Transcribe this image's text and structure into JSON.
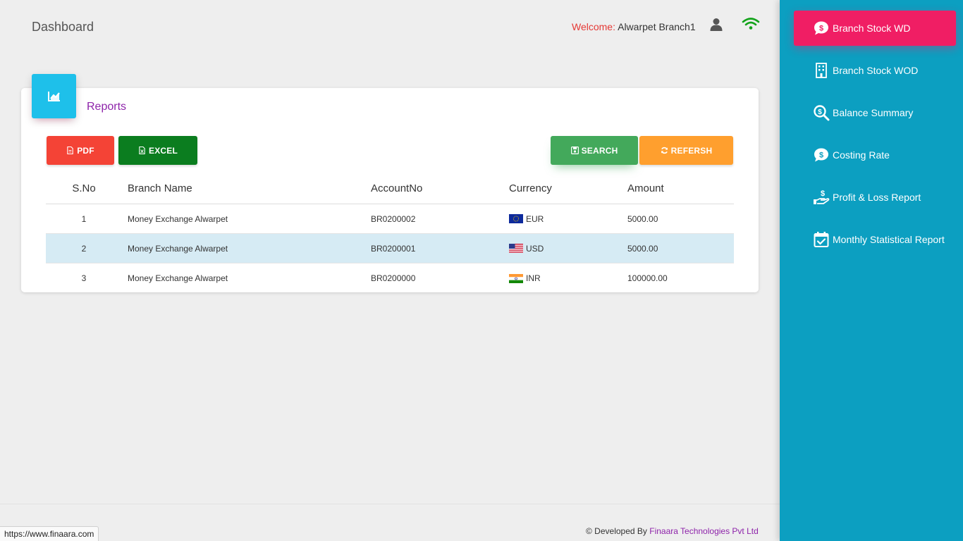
{
  "header": {
    "title": "Dashboard",
    "welcome_label": "Welcome:",
    "welcome_user": "Alwarpet Branch1",
    "icons": {
      "user": "user-icon",
      "connection": "wifi-icon"
    },
    "colors": {
      "welcome_label": "#e53935",
      "wifi": "#13a31b"
    }
  },
  "card": {
    "title": "Reports",
    "icon": "chart-line-icon",
    "buttons": {
      "pdf": "PDF",
      "excel": "EXCEL",
      "search": "SEARCH",
      "refresh": "REFERSH"
    },
    "colors": {
      "pdf": "#f44336",
      "excel": "#0b7d1f",
      "search": "#43a95b",
      "refresh": "#ff9f2e",
      "accent": "#1ec0ea"
    }
  },
  "table": {
    "headers": {
      "sno": "S.No",
      "branch": "Branch Name",
      "account": "AccountNo",
      "currency": "Currency",
      "amount": "Amount"
    },
    "rows": [
      {
        "sno": "1",
        "branch": "Money Exchange Alwarpet",
        "account": "BR0200002",
        "currency": "EUR",
        "flag": "eu-flag-icon",
        "amount": "5000.00"
      },
      {
        "sno": "2",
        "branch": "Money Exchange Alwarpet",
        "account": "BR0200001",
        "currency": "USD",
        "flag": "us-flag-icon",
        "amount": "5000.00"
      },
      {
        "sno": "3",
        "branch": "Money Exchange Alwarpet",
        "account": "BR0200000",
        "currency": "INR",
        "flag": "in-flag-icon",
        "amount": "100000.00"
      }
    ]
  },
  "footer": {
    "prefix": "© Developed By",
    "company": "Finaara Technologies Pvt Ltd",
    "status_url": "https://www.finaara.com"
  },
  "sidebar": {
    "colors": {
      "background": "#0c9fc1",
      "active": "#f01e64"
    },
    "items": [
      {
        "label": "Branch Stock WD",
        "icon": "dollar-chat-icon",
        "active": true
      },
      {
        "label": "Branch Stock WOD",
        "icon": "building-icon",
        "active": false
      },
      {
        "label": "Balance Summary",
        "icon": "search-dollar-icon",
        "active": false
      },
      {
        "label": "Costing Rate",
        "icon": "dollar-chat-icon",
        "active": false
      },
      {
        "label": "Profit & Loss Report",
        "icon": "hand-dollar-icon",
        "active": false
      },
      {
        "label": "Monthly Statistical Report",
        "icon": "calendar-check-icon",
        "active": false
      }
    ]
  }
}
